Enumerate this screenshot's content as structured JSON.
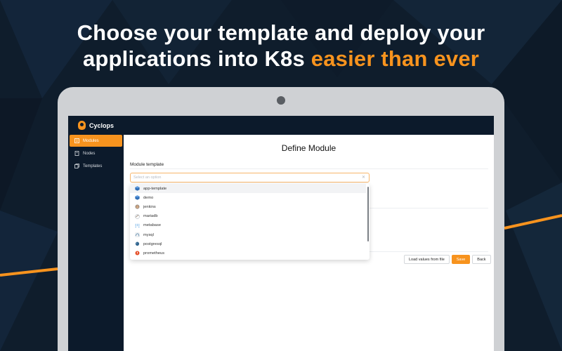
{
  "headline": {
    "line1": "Choose your template and deploy your",
    "line2_plain": "applications into K8s ",
    "line2_accent": "easier than ever"
  },
  "colors": {
    "accent": "#f7931e",
    "navy": "#0c1a2b",
    "background": "#0f1d2c"
  },
  "app": {
    "name": "Cyclops"
  },
  "sidebar": {
    "items": [
      {
        "label": "Modules",
        "icon": "modules-icon",
        "active": true
      },
      {
        "label": "Nodes",
        "icon": "nodes-icon",
        "active": false
      },
      {
        "label": "Templates",
        "icon": "templates-icon",
        "active": false
      }
    ]
  },
  "main": {
    "title": "Define Module",
    "section_label": "Module template",
    "select": {
      "placeholder": "Select an option",
      "value": ""
    },
    "options": [
      {
        "label": "app-template",
        "icon": "cube-icon"
      },
      {
        "label": "demo",
        "icon": "cube-icon"
      },
      {
        "label": "jenkins",
        "icon": "jenkins-icon"
      },
      {
        "label": "mariadb",
        "icon": "mariadb-icon"
      },
      {
        "label": "metabase",
        "icon": "metabase-icon"
      },
      {
        "label": "mysql",
        "icon": "mysql-icon"
      },
      {
        "label": "postgresql",
        "icon": "postgresql-icon"
      },
      {
        "label": "prometheus",
        "icon": "prometheus-icon"
      }
    ],
    "buttons": {
      "load": "Load values from file",
      "save": "Save",
      "back": "Back"
    }
  }
}
